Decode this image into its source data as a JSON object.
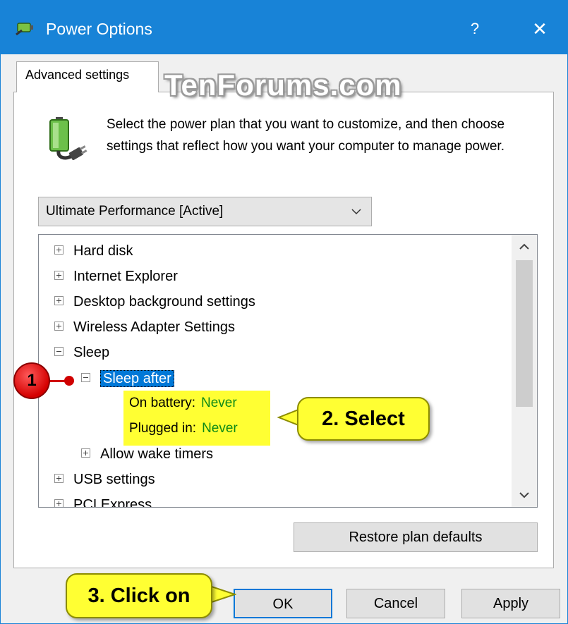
{
  "window": {
    "title": "Power Options",
    "help_label": "?",
    "close_label": "✕"
  },
  "tab": {
    "label": "Advanced settings"
  },
  "watermark": "TenForums.com",
  "description": "Select the power plan that you want to customize, and then choose settings that reflect how you want your computer to manage power.",
  "plan_select": {
    "value": "Ultimate Performance [Active]"
  },
  "tree": {
    "items": [
      {
        "label": "Hard disk",
        "expander": "plus"
      },
      {
        "label": "Internet Explorer",
        "expander": "plus"
      },
      {
        "label": "Desktop background settings",
        "expander": "plus"
      },
      {
        "label": "Wireless Adapter Settings",
        "expander": "plus"
      },
      {
        "label": "Sleep",
        "expander": "minus"
      },
      {
        "label": "Sleep after",
        "expander": "minus",
        "selected": true
      },
      {
        "label": "Allow wake timers",
        "expander": "plus"
      },
      {
        "label": "USB settings",
        "expander": "plus"
      },
      {
        "label": "PCI Express",
        "expander": "plus"
      }
    ],
    "sleep_after_values": [
      {
        "label": "On battery:",
        "value": "Never"
      },
      {
        "label": "Plugged in:",
        "value": "Never"
      }
    ]
  },
  "buttons": {
    "restore": "Restore plan defaults",
    "ok": "OK",
    "cancel": "Cancel",
    "apply": "Apply"
  },
  "callouts": {
    "step1": "1",
    "step2": "2. Select",
    "step3": "3. Click on"
  },
  "colors": {
    "titlebar": "#1883d7",
    "selection": "#0078d7",
    "highlight": "#ffff33",
    "value_text": "#0d8a17",
    "callout_red": "#d40000"
  }
}
